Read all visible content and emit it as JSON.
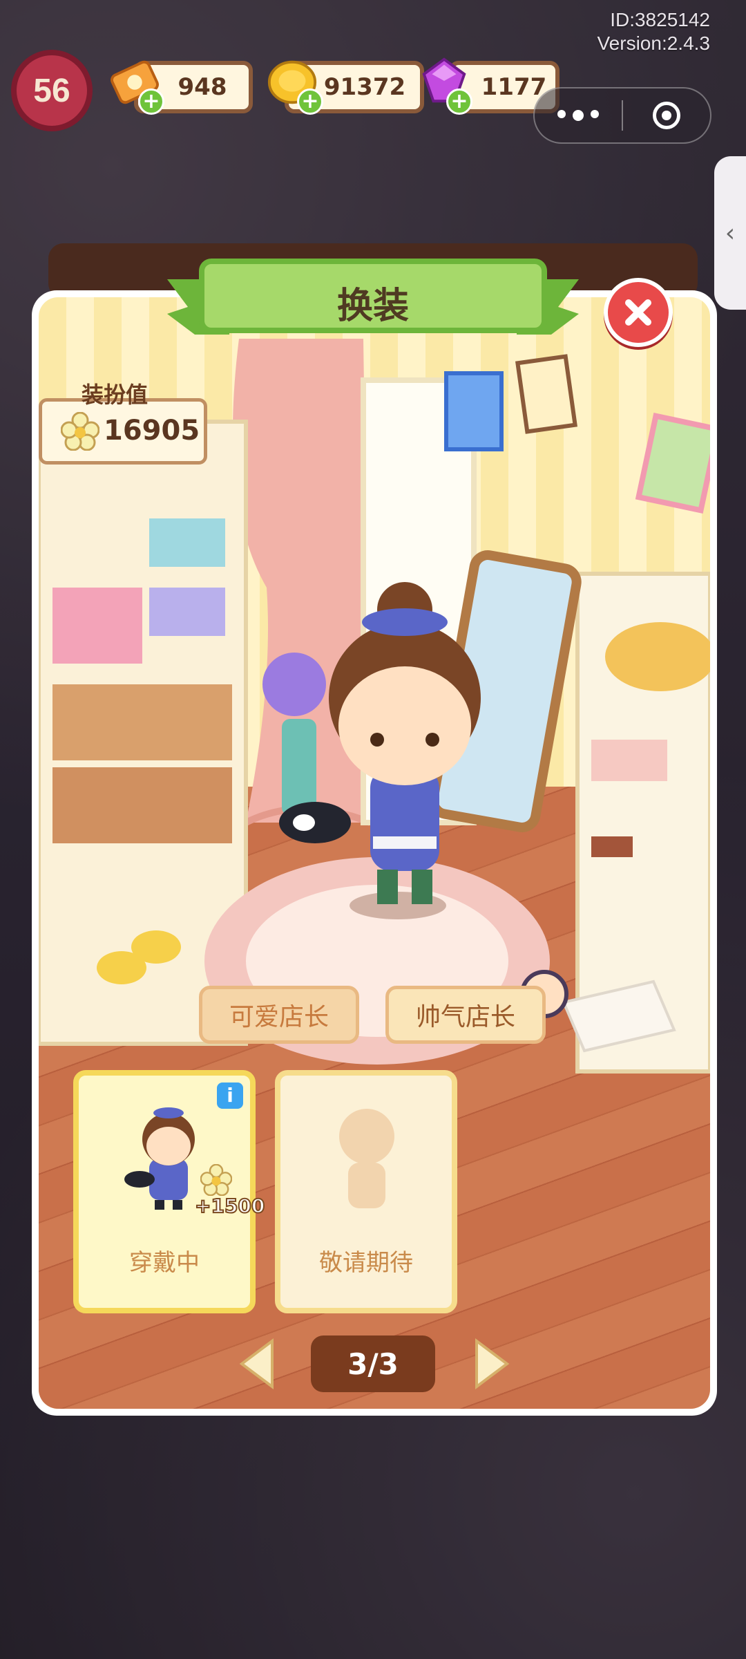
{
  "header": {
    "id_text": "ID:3825142",
    "version_text": "Version:2.4.3",
    "level": "56"
  },
  "currencies": [
    {
      "name": "clover-ticket",
      "value": "948",
      "color": "#f29a3a"
    },
    {
      "name": "gold-coin",
      "value": "91372",
      "color": "#f3b41c"
    },
    {
      "name": "gem",
      "value": "1177",
      "color": "#c34be0"
    }
  ],
  "panel": {
    "title": "换装",
    "dress_label": "装扮值",
    "dress_value": "16905",
    "tabs": [
      {
        "label": "可爱店长",
        "active": false
      },
      {
        "label": "帅气店长",
        "active": true
      }
    ],
    "cards": [
      {
        "status": "穿戴中",
        "bonus": "+1500",
        "info": "i"
      },
      {
        "status": "敬请期待"
      }
    ],
    "pager": "3/3"
  },
  "colors": {
    "title_green": "#8ccf4a",
    "close_red": "#e84a4a",
    "card_yellow": "#f5d85a"
  }
}
